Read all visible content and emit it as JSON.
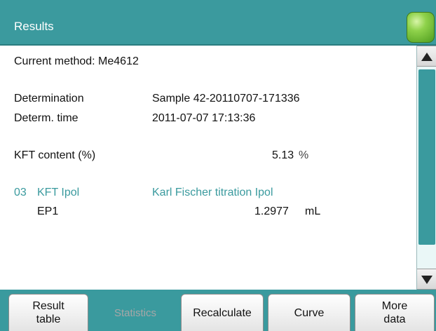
{
  "header": {
    "title": "Results"
  },
  "results": {
    "current_method": "Current method: Me4612",
    "determination_label": "Determination",
    "determination_value": "Sample 42-20110707-171336",
    "determ_time_label": "Determ. time",
    "determ_time_value": "2011-07-07 17:13:36",
    "kft_label": "KFT content (%)",
    "kft_value": "5.13",
    "kft_unit": "%",
    "command_number": "03",
    "command_name": "KFT Ipol",
    "command_desc": "Karl Fischer titration Ipol",
    "ep_label": "EP1",
    "ep_value": "1.2977",
    "ep_unit": "mL"
  },
  "toolbar": {
    "result_table": [
      "Result",
      "table"
    ],
    "statistics": "Statistics",
    "recalculate": "Recalculate",
    "curve": "Curve",
    "more_data": [
      "More",
      "data"
    ]
  },
  "colors": {
    "accent": "#3a9a9e",
    "status_led": "#8fd24b"
  },
  "icons": {
    "scroll_up": "triangle-up-icon",
    "scroll_down": "triangle-down-icon"
  }
}
